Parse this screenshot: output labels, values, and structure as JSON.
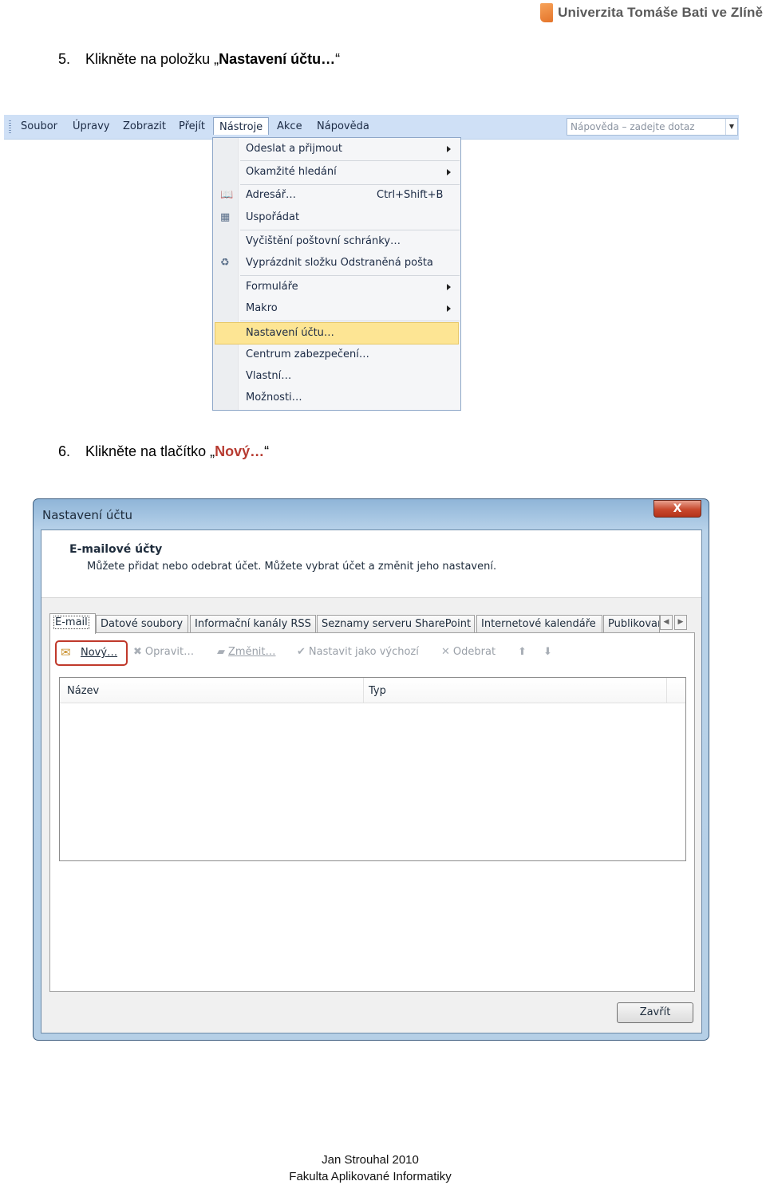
{
  "logo": {
    "text": "Univerzita Tomáše Bati ve Zlíně"
  },
  "step5": {
    "num": "5.",
    "text_before": "Klikněte na položku „",
    "bold": "Nastavení účtu…",
    "text_after": "“"
  },
  "step6": {
    "num": "6.",
    "text_before": "Klikněte na tlačítko „",
    "bold": "Nový…",
    "text_after": "“"
  },
  "menubar": {
    "items": [
      "Soubor",
      "Úpravy",
      "Zobrazit",
      "Přejít",
      "Nástroje",
      "Akce",
      "Nápověda"
    ],
    "help_placeholder": "Nápověda – zadejte dotaz"
  },
  "tools_menu": {
    "items": [
      {
        "label": "Odeslat a přijmout"
      },
      {
        "label": "Okamžité hledání"
      },
      {
        "label": "Adresář…",
        "shortcut": "Ctrl+Shift+B"
      },
      {
        "label": "Uspořádat"
      },
      {
        "label": "Vyčištění poštovní schránky…"
      },
      {
        "label": "Vyprázdnit složku Odstraněná pošta"
      },
      {
        "label": "Formuláře"
      },
      {
        "label": "Makro"
      },
      {
        "label": "Nastavení účtu…"
      },
      {
        "label": "Centrum zabezpečení…"
      },
      {
        "label": "Vlastní…"
      },
      {
        "label": "Možnosti…"
      }
    ]
  },
  "dialog": {
    "title": "Nastavení účtu",
    "close": "X",
    "header_title": "E-mailové účty",
    "header_sub": "Můžete přidat nebo odebrat účet. Můžete vybrat účet a změnit jeho nastavení.",
    "tabs": [
      "E-mail",
      "Datové soubory",
      "Informační kanály RSS",
      "Seznamy serveru SharePoint",
      "Internetové kalendáře",
      "Publikované kalendáře"
    ],
    "toolbar": {
      "new": "Nový…",
      "repair": "Opravit…",
      "change": "Změnit…",
      "default": "Nastavit jako výchozí",
      "remove": "Odebrat"
    },
    "columns": [
      "Název",
      "Typ"
    ],
    "close_button": "Zavřít"
  },
  "footer": {
    "line1": "Jan Strouhal 2010",
    "line2": "Fakulta Aplikované Informatiky"
  }
}
